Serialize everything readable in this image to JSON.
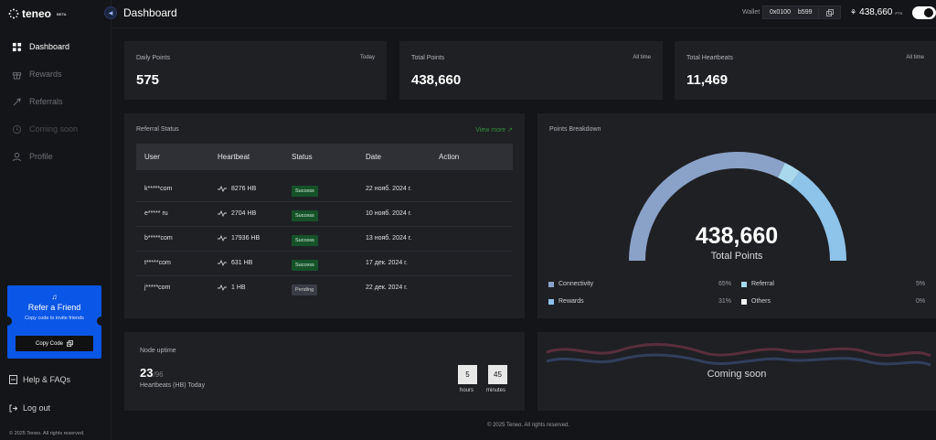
{
  "brand": {
    "name": "teneo",
    "badge": "BETA"
  },
  "sidebar": {
    "items": [
      {
        "label": "Dashboard",
        "icon": "dashboard-icon",
        "active": true
      },
      {
        "label": "Rewards",
        "icon": "gift-icon"
      },
      {
        "label": "Referrals",
        "icon": "rocket-icon"
      },
      {
        "label": "Coming soon",
        "icon": "clock-icon"
      },
      {
        "label": "Profile",
        "icon": "user-icon"
      }
    ],
    "refer": {
      "title": "Refer a Friend",
      "subtitle": "Copy code to invite friends",
      "button": "Copy Code"
    },
    "help": "Help & FAQs",
    "logout": "Log out",
    "copyright": "© 2025 Teneo. All rights reserved."
  },
  "header": {
    "title": "Dashboard",
    "wallet_label": "Wallet",
    "wallet_start": "0x0100",
    "wallet_end": "b599",
    "points": "438,660",
    "points_unit": "PTS"
  },
  "stats": [
    {
      "label": "Daily Points",
      "tag": "Today",
      "value": "575"
    },
    {
      "label": "Total Points",
      "tag": "All time",
      "value": "438,660"
    },
    {
      "label": "Total Heartbeats",
      "tag": "All time",
      "value": "11,469"
    }
  ],
  "referral": {
    "title": "Referral Status",
    "view_more": "View more ↗",
    "columns": [
      "User",
      "Heartbeat",
      "Status",
      "Date",
      "Action"
    ],
    "rows": [
      {
        "user": "k*****com",
        "hb": "8276 HB",
        "status": "Success",
        "date": "22 нояб. 2024 г."
      },
      {
        "user": "e***** ru",
        "hb": "2704 HB",
        "status": "Success",
        "date": "10 нояб. 2024 г."
      },
      {
        "user": "b*****com",
        "hb": "17936 HB",
        "status": "Success",
        "date": "13 нояб. 2024 г."
      },
      {
        "user": "t*****com",
        "hb": "631 HB",
        "status": "Success",
        "date": "17 дек. 2024 г."
      },
      {
        "user": "j*****com",
        "hb": "1 HB",
        "status": "Pending",
        "date": "22 дек. 2024 г."
      }
    ]
  },
  "breakdown": {
    "title": "Points Breakdown",
    "total": "438,660",
    "total_label": "Total Points",
    "legend": [
      {
        "label": "Connectivity",
        "pct": "65%",
        "color": "#8aa2c8"
      },
      {
        "label": "Referral",
        "pct": "5%",
        "color": "#a9d8ec"
      },
      {
        "label": "Rewards",
        "pct": "31%",
        "color": "#8ec3ea"
      },
      {
        "label": "Others",
        "pct": "0%",
        "color": "#f2f2f2"
      }
    ]
  },
  "uptime": {
    "title": "Node uptime",
    "value": "23",
    "total": "/96",
    "label": "Heartbeats (HB) Today",
    "hours": "5",
    "hours_label": "hours",
    "minutes": "45",
    "minutes_label": "minutes"
  },
  "coming_soon": "Coming soon",
  "footer": "© 2025 Teneo. All rights reserved."
}
